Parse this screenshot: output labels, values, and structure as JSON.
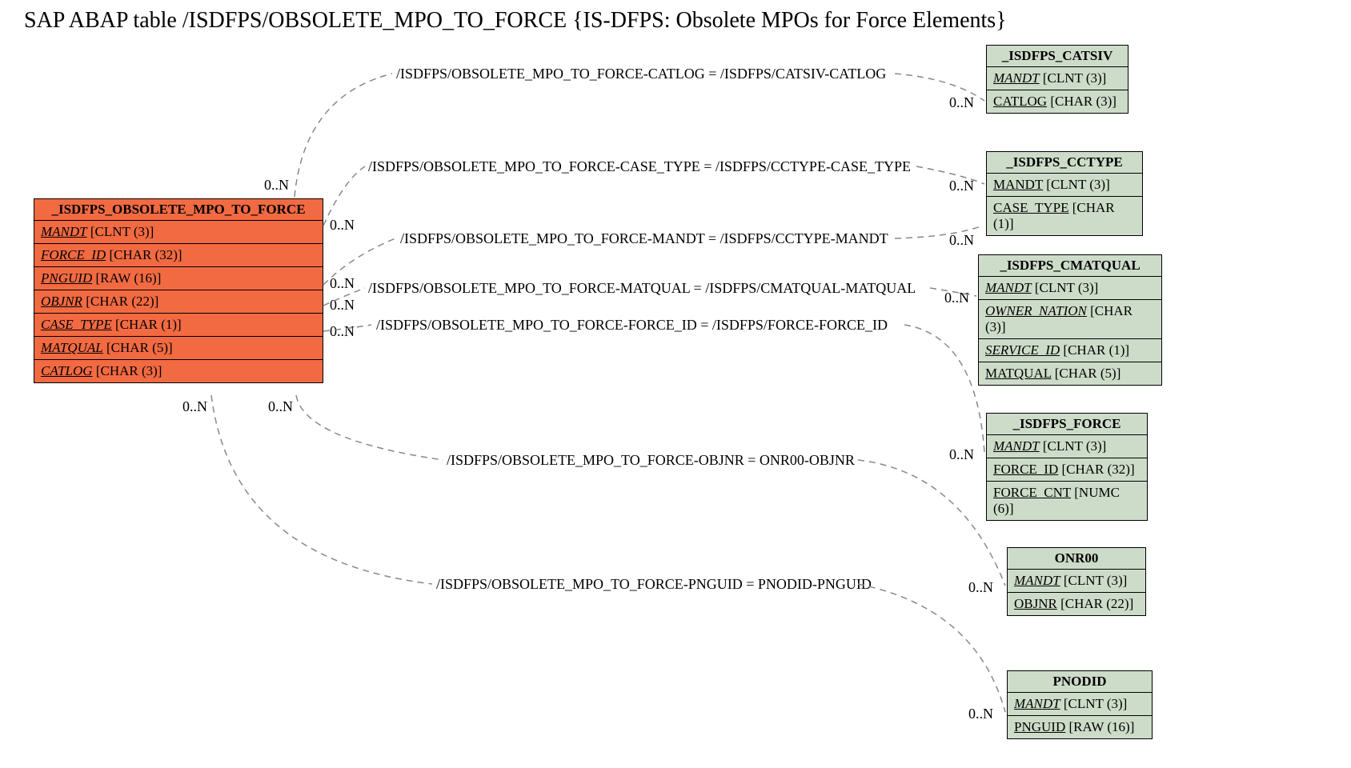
{
  "title": "SAP ABAP table /ISDFPS/OBSOLETE_MPO_TO_FORCE {IS-DFPS: Obsolete MPOs for Force Elements}",
  "main_entity": {
    "name": "_ISDFPS_OBSOLETE_MPO_TO_FORCE",
    "fields": [
      {
        "name": "MANDT",
        "type": "[CLNT (3)]",
        "fk": true
      },
      {
        "name": "FORCE_ID",
        "type": "[CHAR (32)]",
        "fk": true
      },
      {
        "name": "PNGUID",
        "type": "[RAW (16)]",
        "fk": true
      },
      {
        "name": "OBJNR",
        "type": "[CHAR (22)]",
        "fk": true
      },
      {
        "name": "CASE_TYPE",
        "type": "[CHAR (1)]",
        "fk": true
      },
      {
        "name": "MATQUAL",
        "type": "[CHAR (5)]",
        "fk": true
      },
      {
        "name": "CATLOG",
        "type": "[CHAR (3)]",
        "fk": true
      }
    ]
  },
  "related_entities": [
    {
      "name": "_ISDFPS_CATSIV",
      "fields": [
        {
          "name": "MANDT",
          "type": "[CLNT (3)]",
          "fk": true,
          "italic": true
        },
        {
          "name": "CATLOG",
          "type": "[CHAR (3)]",
          "fk": true
        }
      ]
    },
    {
      "name": "_ISDFPS_CCTYPE",
      "fields": [
        {
          "name": "MANDT",
          "type": "[CLNT (3)]",
          "fk": true
        },
        {
          "name": "CASE_TYPE",
          "type": "[CHAR (1)]",
          "fk": true
        }
      ]
    },
    {
      "name": "_ISDFPS_CMATQUAL",
      "fields": [
        {
          "name": "MANDT",
          "type": "[CLNT (3)]",
          "fk": true,
          "italic": true
        },
        {
          "name": "OWNER_NATION",
          "type": "[CHAR (3)]",
          "fk": true,
          "italic": true
        },
        {
          "name": "SERVICE_ID",
          "type": "[CHAR (1)]",
          "fk": true,
          "italic": true
        },
        {
          "name": "MATQUAL",
          "type": "[CHAR (5)]",
          "fk": true
        }
      ]
    },
    {
      "name": "_ISDFPS_FORCE",
      "fields": [
        {
          "name": "MANDT",
          "type": "[CLNT (3)]",
          "fk": true,
          "italic": true
        },
        {
          "name": "FORCE_ID",
          "type": "[CHAR (32)]",
          "fk": true
        },
        {
          "name": "FORCE_CNT",
          "type": "[NUMC (6)]",
          "fk": true
        }
      ]
    },
    {
      "name": "ONR00",
      "fields": [
        {
          "name": "MANDT",
          "type": "[CLNT (3)]",
          "fk": true,
          "italic": true
        },
        {
          "name": "OBJNR",
          "type": "[CHAR (22)]",
          "fk": true
        }
      ]
    },
    {
      "name": "PNODID",
      "fields": [
        {
          "name": "MANDT",
          "type": "[CLNT (3)]",
          "fk": true,
          "italic": true
        },
        {
          "name": "PNGUID",
          "type": "[RAW (16)]",
          "fk": true
        }
      ]
    }
  ],
  "relations": [
    {
      "label": "/ISDFPS/OBSOLETE_MPO_TO_FORCE-CATLOG = /ISDFPS/CATSIV-CATLOG"
    },
    {
      "label": "/ISDFPS/OBSOLETE_MPO_TO_FORCE-CASE_TYPE = /ISDFPS/CCTYPE-CASE_TYPE"
    },
    {
      "label": "/ISDFPS/OBSOLETE_MPO_TO_FORCE-MANDT = /ISDFPS/CCTYPE-MANDT"
    },
    {
      "label": "/ISDFPS/OBSOLETE_MPO_TO_FORCE-MATQUAL = /ISDFPS/CMATQUAL-MATQUAL"
    },
    {
      "label": "/ISDFPS/OBSOLETE_MPO_TO_FORCE-FORCE_ID = /ISDFPS/FORCE-FORCE_ID"
    },
    {
      "label": "/ISDFPS/OBSOLETE_MPO_TO_FORCE-OBJNR = ONR00-OBJNR"
    },
    {
      "label": "/ISDFPS/OBSOLETE_MPO_TO_FORCE-PNGUID = PNODID-PNGUID"
    }
  ],
  "cards": {
    "left_near_main": [
      "0..N",
      "0..N",
      "0..N",
      "0..N",
      "0..N",
      "0..N",
      "0..N"
    ],
    "right_near_related": [
      "0..N",
      "0..N",
      "0..N",
      "0..N",
      "0..N",
      "0..N",
      "0..N"
    ]
  }
}
